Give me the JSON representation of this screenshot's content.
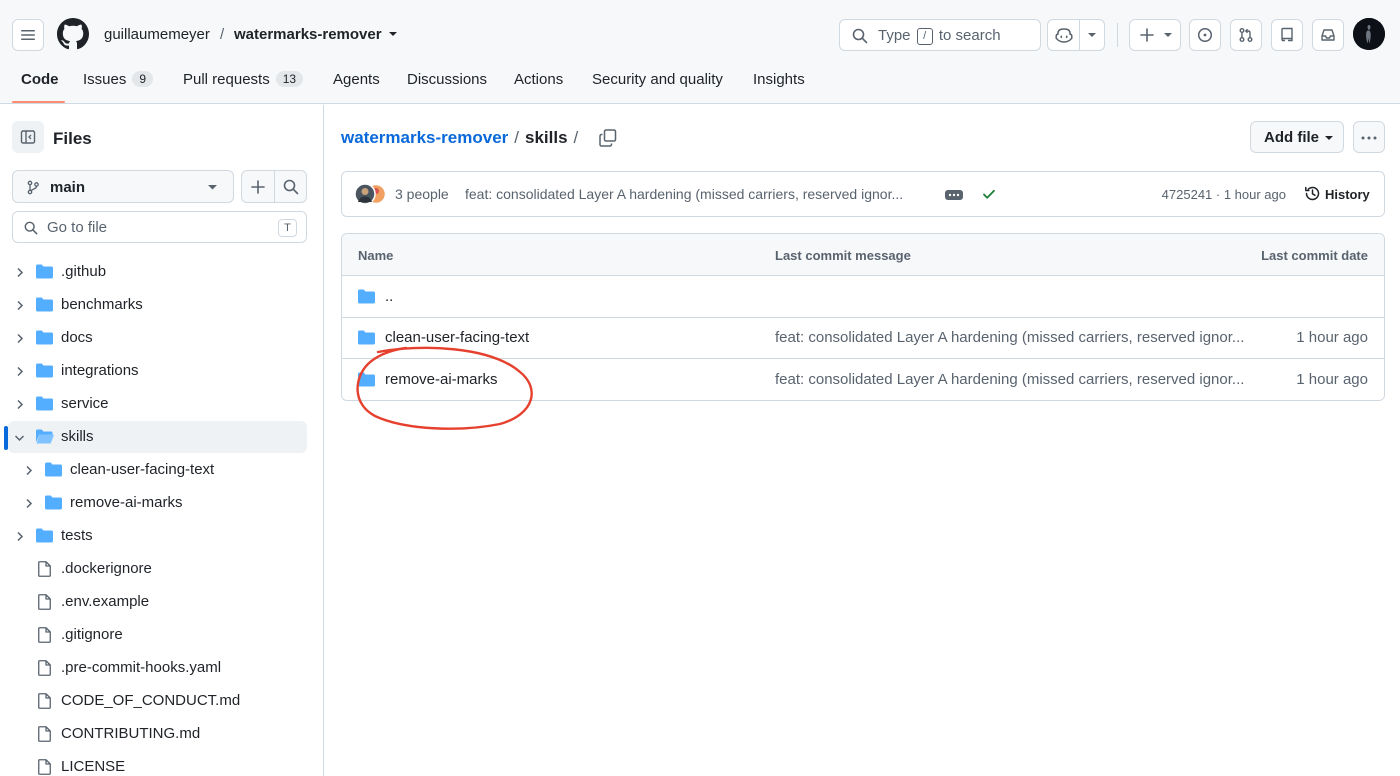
{
  "header": {
    "owner": "guillaumemeyer",
    "separator": "/",
    "repo": "watermarks-remover",
    "search": {
      "before": "Type",
      "key": "/",
      "after": "to search"
    },
    "icons": [
      "hamburger-icon",
      "github-logo-icon",
      "copilot-icon",
      "plus-icon",
      "issue-icon",
      "pull-request-icon",
      "repo-icon",
      "inbox-icon"
    ]
  },
  "tabs": [
    {
      "label": "Code"
    },
    {
      "label": "Issues",
      "count": "9"
    },
    {
      "label": "Pull requests",
      "count": "13"
    },
    {
      "label": "Agents"
    },
    {
      "label": "Discussions"
    },
    {
      "label": "Actions"
    },
    {
      "label": "Security and quality"
    },
    {
      "label": "Insights"
    }
  ],
  "sidebar": {
    "title": "Files",
    "branch": "main",
    "goto_placeholder": "Go to file",
    "goto_key": "T",
    "tree": [
      {
        "label": ".github",
        "type": "dir"
      },
      {
        "label": "benchmarks",
        "type": "dir"
      },
      {
        "label": "docs",
        "type": "dir"
      },
      {
        "label": "integrations",
        "type": "dir"
      },
      {
        "label": "service",
        "type": "dir"
      },
      {
        "label": "skills",
        "type": "dir-open"
      },
      {
        "label": "clean-user-facing-text",
        "type": "dir"
      },
      {
        "label": "remove-ai-marks",
        "type": "dir"
      },
      {
        "label": "tests",
        "type": "dir"
      },
      {
        "label": ".dockerignore",
        "type": "file"
      },
      {
        "label": ".env.example",
        "type": "file"
      },
      {
        "label": ".gitignore",
        "type": "file"
      },
      {
        "label": ".pre-commit-hooks.yaml",
        "type": "file"
      },
      {
        "label": "CODE_OF_CONDUCT.md",
        "type": "file"
      },
      {
        "label": "CONTRIBUTING.md",
        "type": "file"
      },
      {
        "label": "LICENSE",
        "type": "file"
      }
    ]
  },
  "main": {
    "breadcrumb": {
      "repo": "watermarks-remover",
      "sep": "/",
      "current": "skills",
      "trail": "/"
    },
    "add_file": "Add file",
    "commit": {
      "people": "3 people",
      "message": "feat: consolidated Layer A hardening (missed carriers, reserved ignor...",
      "sha_time": "4725241 · 1 hour ago",
      "history": "History"
    },
    "table": {
      "headers": {
        "name": "Name",
        "message": "Last commit message",
        "date": "Last commit date"
      },
      "parent": "..",
      "rows": [
        {
          "name": "clean-user-facing-text",
          "message": "feat: consolidated Layer A hardening (missed carriers, reserved ignor...",
          "date": "1 hour ago"
        },
        {
          "name": "remove-ai-marks",
          "message": "feat: consolidated Layer A hardening (missed carriers, reserved ignor...",
          "date": "1 hour ago"
        }
      ]
    }
  },
  "colors": {
    "accent_link": "#0969da",
    "folder": "#54aeff",
    "tab_underline": "#fd8c73",
    "annotation": "#e5412e",
    "success": "#1a7f37"
  }
}
